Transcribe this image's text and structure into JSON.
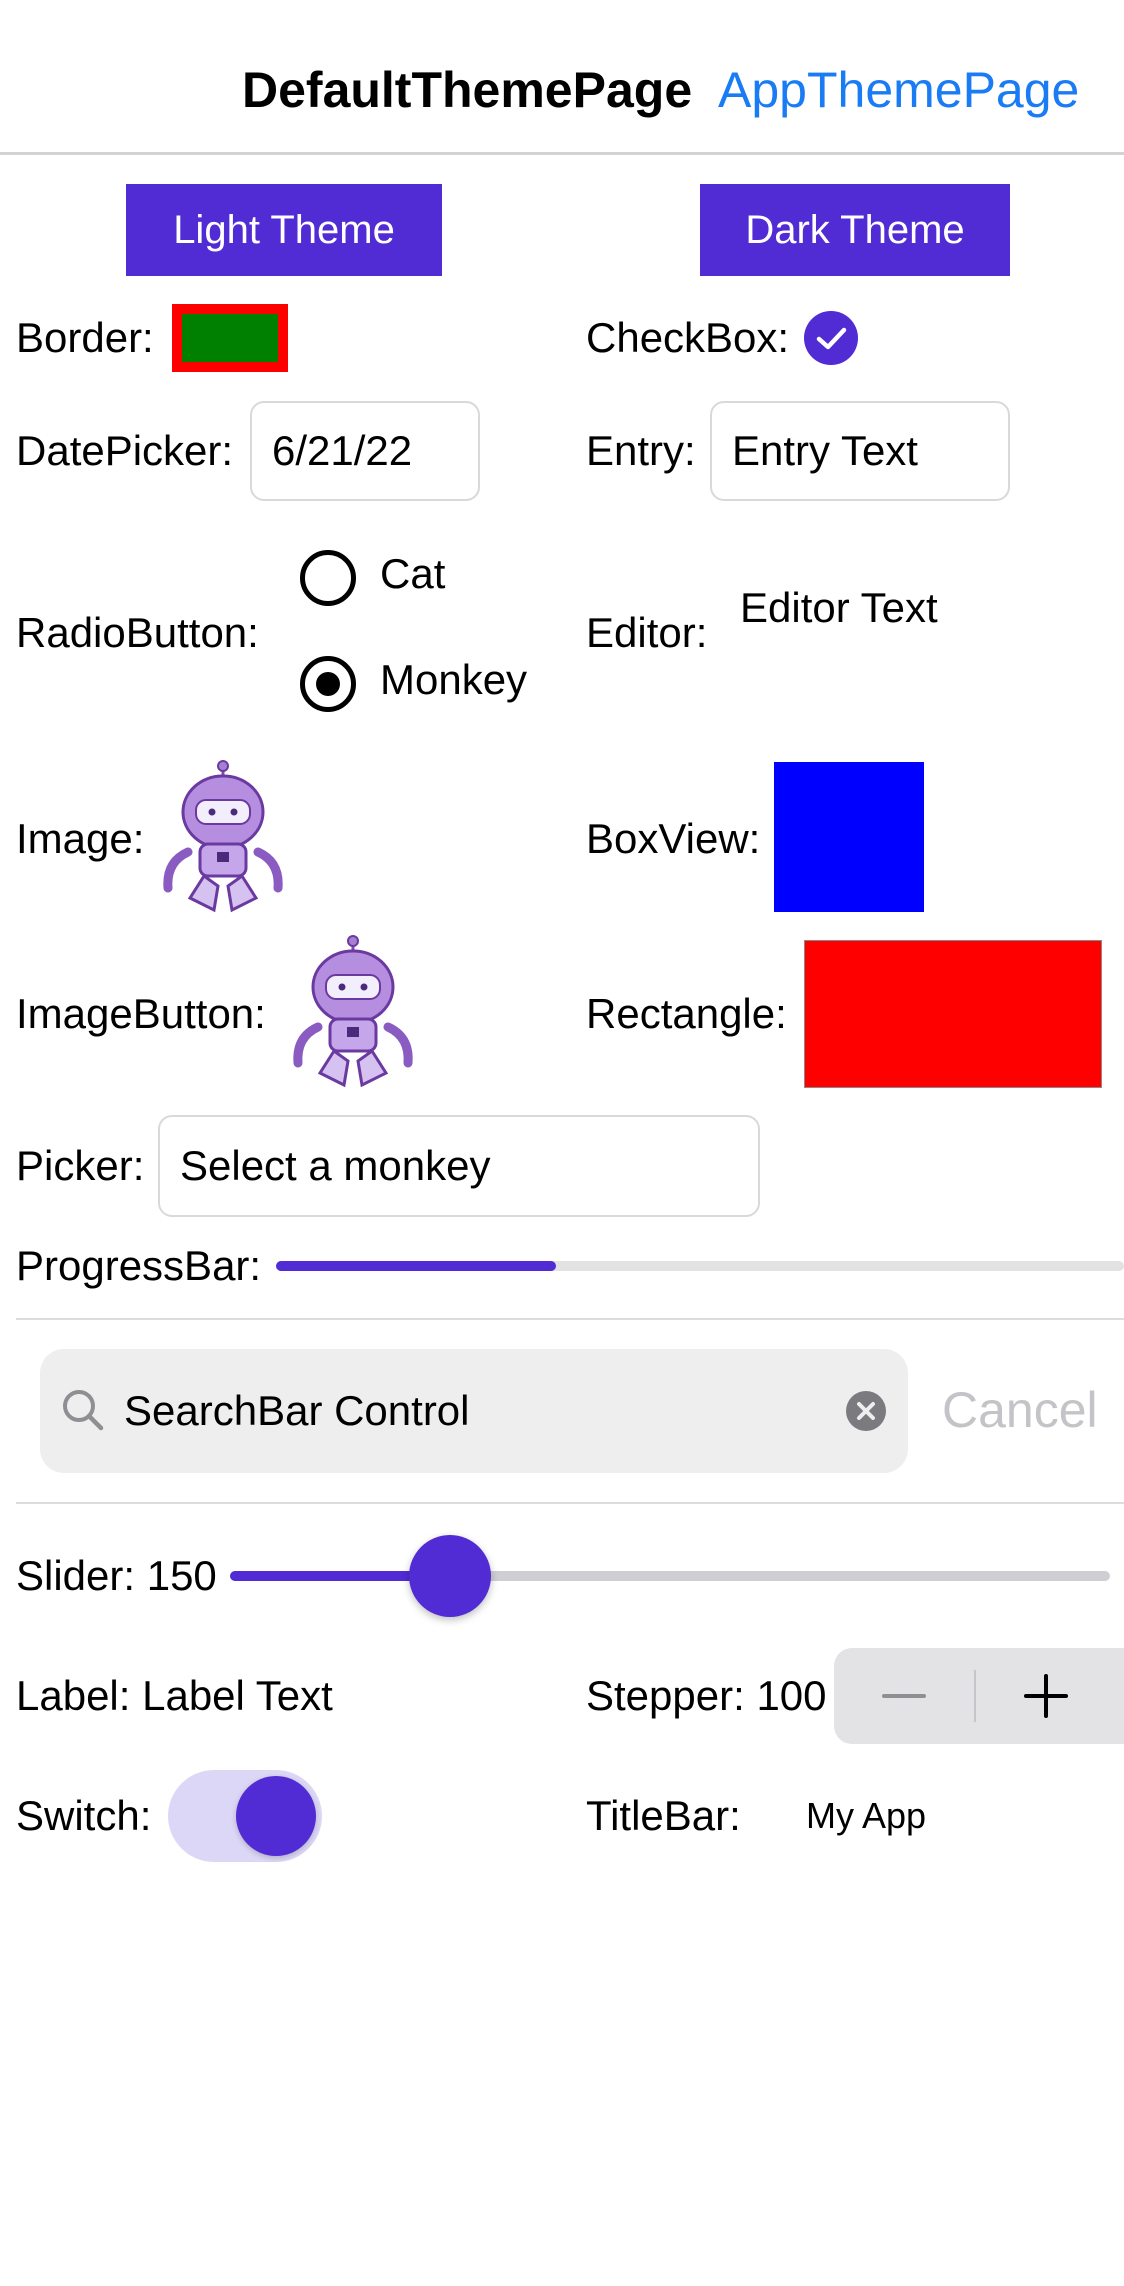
{
  "header": {
    "tabs": [
      {
        "label": "DefaultThemePage",
        "selected": true
      },
      {
        "label": "AppThemePage",
        "selected": false
      }
    ]
  },
  "theme_buttons": {
    "light": "Light Theme",
    "dark": "Dark Theme"
  },
  "border": {
    "label": "Border:",
    "stroke_color": "#ff0000",
    "fill_color": "#008000"
  },
  "checkbox": {
    "label": "CheckBox:",
    "checked": true
  },
  "datepicker": {
    "label": "DatePicker:",
    "value": "6/21/22"
  },
  "entry": {
    "label": "Entry:",
    "value": "Entry Text"
  },
  "radio": {
    "label": "RadioButton:",
    "options": [
      {
        "label": "Cat",
        "selected": false
      },
      {
        "label": "Monkey",
        "selected": true
      }
    ]
  },
  "editor": {
    "label": "Editor:",
    "value": "Editor Text"
  },
  "image": {
    "label": "Image:",
    "icon": "dotnet-bot-icon"
  },
  "boxview": {
    "label": "BoxView:",
    "color": "#0000ff"
  },
  "imagebutton": {
    "label": "ImageButton:",
    "icon": "dotnet-bot-icon"
  },
  "rectangle": {
    "label": "Rectangle:",
    "color": "#ff0000"
  },
  "picker": {
    "label": "Picker:",
    "placeholder": "Select a monkey"
  },
  "progressbar": {
    "label": "ProgressBar:",
    "progress": 0.33
  },
  "searchbar": {
    "text": "SearchBar Control",
    "cancel_label": "Cancel"
  },
  "slider": {
    "label": "Slider: 150",
    "value": 150,
    "min": 0,
    "max": 600
  },
  "label_control": {
    "text": "Label: Label Text"
  },
  "stepper": {
    "label": "Stepper: 100"
  },
  "switch": {
    "label": "Switch:",
    "on": true
  },
  "titlebar": {
    "label": "TitleBar:",
    "title": "My App"
  },
  "colors": {
    "accent": "#512bd4",
    "link": "#1a7cf5"
  }
}
